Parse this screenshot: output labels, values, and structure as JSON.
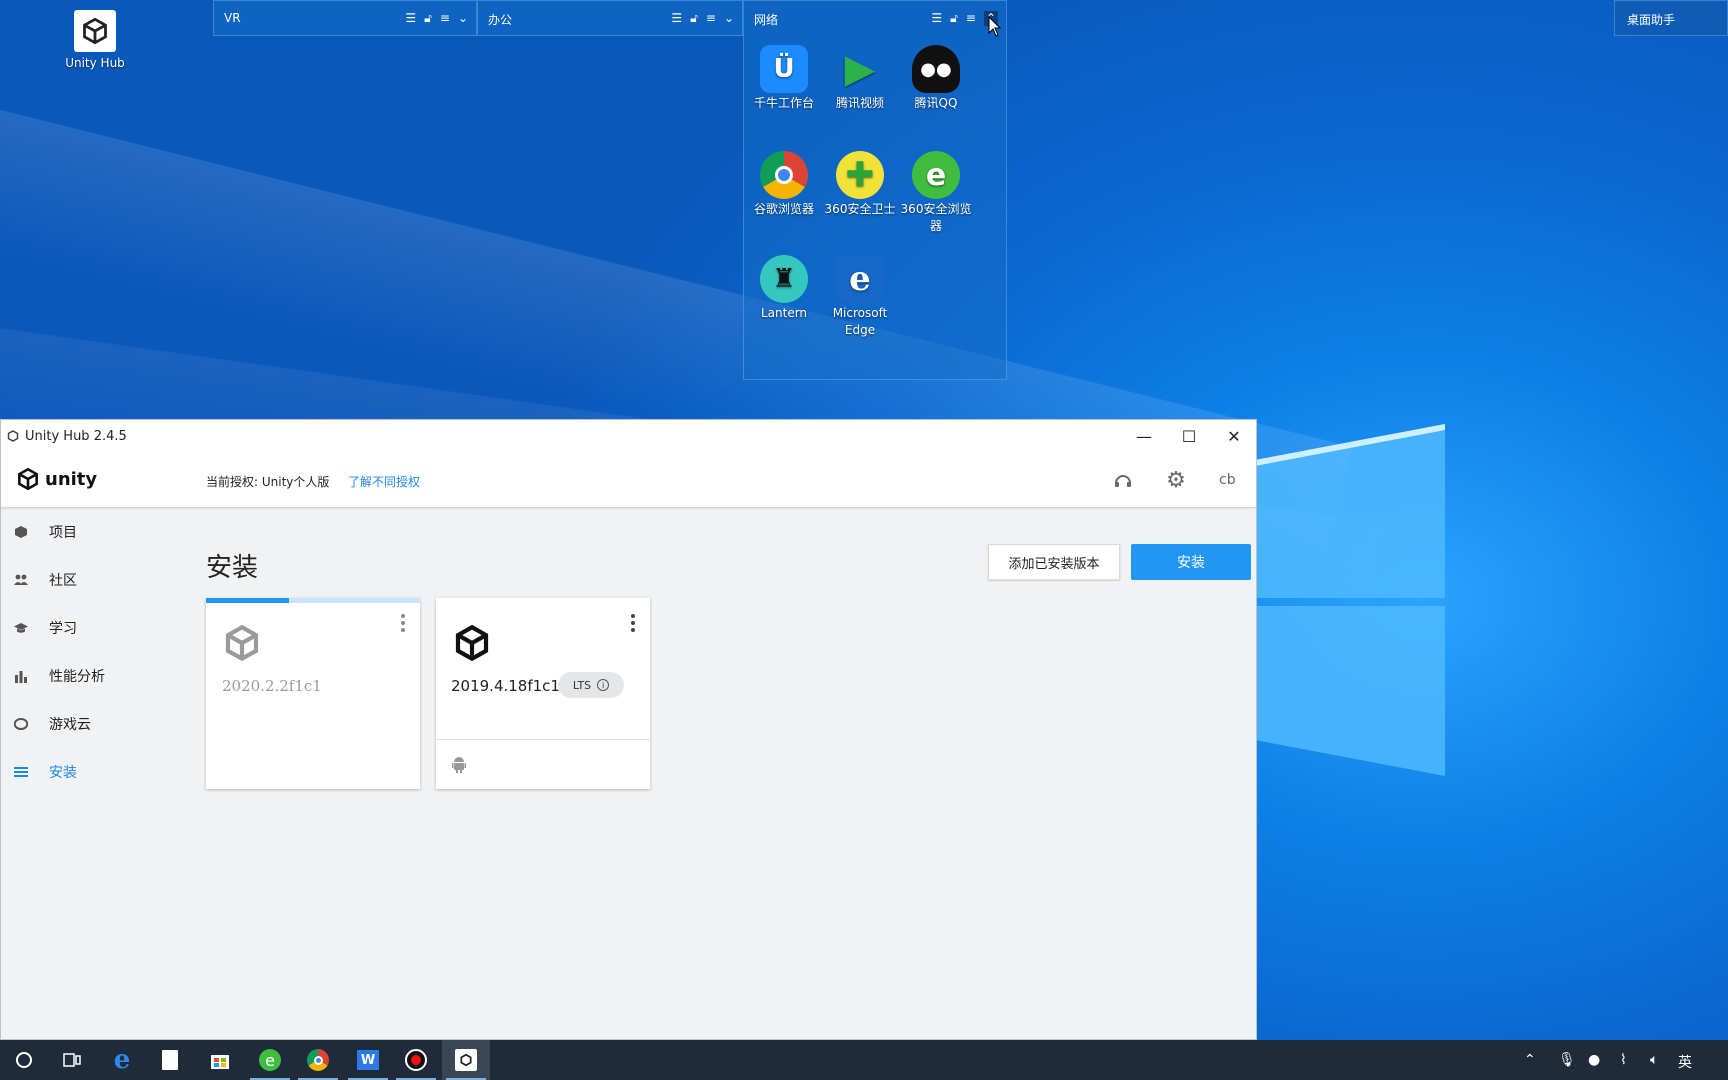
{
  "desktop": {
    "unity_hub_icon": {
      "label": "Unity Hub"
    },
    "helper_label": "桌面助手",
    "fences": [
      {
        "title": "VR"
      },
      {
        "title": "办公"
      },
      {
        "title": "网络"
      }
    ],
    "network_icons": [
      {
        "label": "千牛工作台",
        "glyph": "Ü",
        "color": "#1a8cff"
      },
      {
        "label": "腾讯视频",
        "glyph": "▶",
        "color": "#2bb24c"
      },
      {
        "label": "腾讯QQ",
        "glyph": "🐧",
        "color": "#111111"
      },
      {
        "label": "谷歌浏览器",
        "glyph": "◉",
        "color": "#db4437"
      },
      {
        "label": "360安全卫士",
        "glyph": "✚",
        "color": "#39b54a"
      },
      {
        "label": "360安全浏览器",
        "glyph": "e",
        "color": "#2db24a"
      },
      {
        "label": "Lantern",
        "glyph": "♜",
        "color": "#19a0a0"
      },
      {
        "label": "Microsoft Edge",
        "glyph": "e",
        "color": "#1768c8"
      }
    ]
  },
  "window": {
    "title": "Unity Hub 2.4.5",
    "header": {
      "brand": "unity",
      "license_text": "当前授权: Unity个人版",
      "license_link": "了解不同授权",
      "user": "cb"
    },
    "sidebar": [
      {
        "label": "项目",
        "icon": "cube-icon"
      },
      {
        "label": "社区",
        "icon": "people-icon"
      },
      {
        "label": "学习",
        "icon": "graduation-cap-icon"
      },
      {
        "label": "性能分析",
        "icon": "bar-chart-icon"
      },
      {
        "label": "游戏云",
        "icon": "cloud-icon"
      },
      {
        "label": "安装",
        "icon": "list-icon",
        "active": true
      }
    ],
    "main": {
      "title": "安装",
      "add_installed_button": "添加已安装版本",
      "install_button": "安装",
      "installs": [
        {
          "version": "2020.2.2f1c1",
          "progress": 0.39,
          "installing": true
        },
        {
          "version": "2019.4.18f1c1",
          "badge": "LTS",
          "modules": [
            "android-icon"
          ]
        }
      ]
    }
  },
  "taskbar": {
    "items": [
      "cortana-icon",
      "task-view-icon",
      "edge-icon",
      "notepad-icon",
      "store-icon",
      "360-browser-icon",
      "chrome-icon",
      "wps-icon",
      "record-icon",
      "unity-hub-icon"
    ],
    "tray": {
      "input_method": "英"
    }
  },
  "colors": {
    "accent": "#2196f3",
    "link": "#1e88e5"
  }
}
